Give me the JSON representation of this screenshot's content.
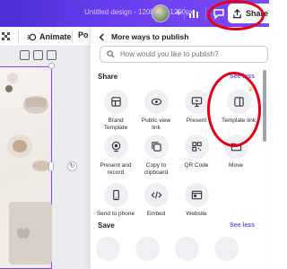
{
  "topbar": {
    "doc_title": "Untitled design - 1200px × 1200px",
    "share_label": "Share",
    "colors": {
      "bar_start": "#4d2fd3",
      "bar_end": "#7c4bf2"
    }
  },
  "editor_toolbar": {
    "animate_label": "Animate",
    "position_label": "Po"
  },
  "share_panel": {
    "title": "More ways to publish",
    "search_placeholder": "How would you like to publish?",
    "share_section": {
      "title": "Share",
      "see_less": "See less",
      "tiles": [
        {
          "label": "Brand Template",
          "icon": "brand-template-icon"
        },
        {
          "label": "Public view link",
          "icon": "link-eye-icon"
        },
        {
          "label": "Present",
          "icon": "present-icon"
        },
        {
          "label": "Template link",
          "icon": "template-link-icon",
          "premium": true
        },
        {
          "label": "Present and record",
          "icon": "present-record-icon"
        },
        {
          "label": "Copy to clipboard",
          "icon": "copy-icon"
        },
        {
          "label": "QR Code",
          "icon": "qr-code-icon"
        },
        {
          "label": "Move",
          "icon": "folder-icon"
        },
        {
          "label": "Send to phone",
          "icon": "phone-icon"
        },
        {
          "label": "Embed",
          "icon": "embed-icon"
        },
        {
          "label": "Website",
          "icon": "website-icon"
        }
      ]
    },
    "save_section": {
      "title": "Save",
      "see_less": "See less"
    }
  },
  "accent_color": "#6b4ff0",
  "annotation_color": "#e5001a"
}
